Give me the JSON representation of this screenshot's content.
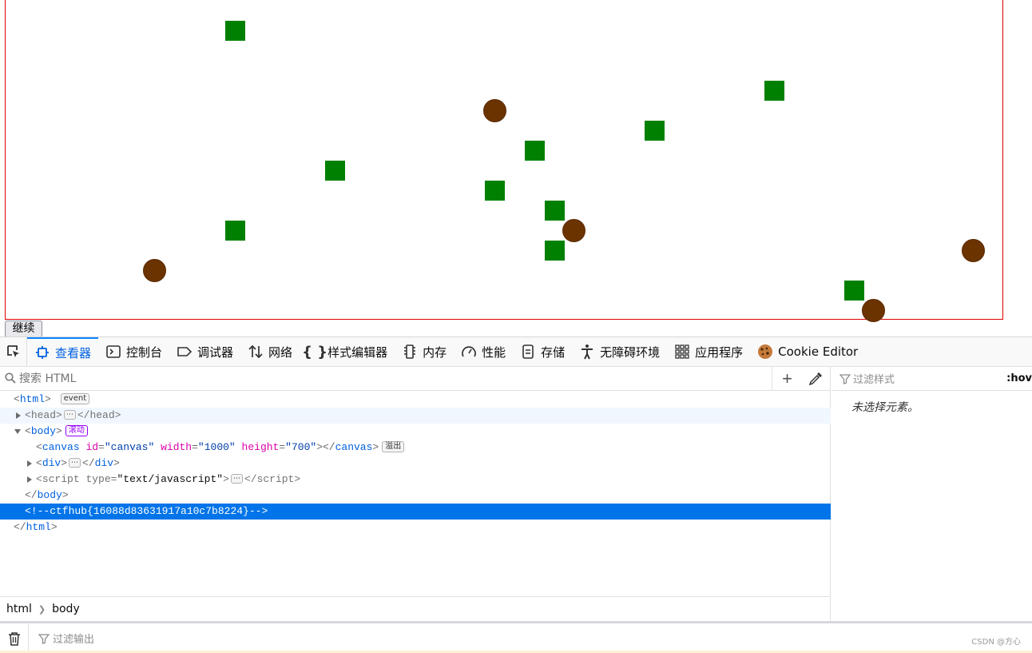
{
  "page": {
    "continue_label": "继续",
    "canvas": {
      "border_color": "#e00000",
      "square_color": "#008000",
      "ball_color": "#6b3300"
    }
  },
  "devtools": {
    "tabs": [
      {
        "label": "查看器",
        "icon": "inspector-icon",
        "active": true
      },
      {
        "label": "控制台",
        "icon": "console-icon"
      },
      {
        "label": "调试器",
        "icon": "debugger-icon"
      },
      {
        "label": "网络",
        "icon": "network-icon"
      },
      {
        "label": "样式编辑器",
        "icon": "style-editor-icon"
      },
      {
        "label": "内存",
        "icon": "memory-icon"
      },
      {
        "label": "性能",
        "icon": "performance-icon"
      },
      {
        "label": "存储",
        "icon": "storage-icon"
      },
      {
        "label": "无障碍环境",
        "icon": "accessibility-icon"
      },
      {
        "label": "应用程序",
        "icon": "application-icon"
      },
      {
        "label": "Cookie Editor",
        "icon": "cookie-icon"
      }
    ],
    "search": {
      "placeholder": "搜索 HTML"
    },
    "tree": {
      "html_open": "html",
      "event_badge": "event",
      "head": "head",
      "body": "body",
      "scroll_badge": "滚动",
      "canvas_tag": "canvas",
      "canvas_id_attr": "id",
      "canvas_id_val": "\"canvas\"",
      "canvas_width_attr": "width",
      "canvas_width_val": "\"1000\"",
      "canvas_height_attr": "height",
      "canvas_height_val": "\"700\"",
      "overflow_badge": "溢出",
      "div": "div",
      "script": "script",
      "script_type_attr": "type",
      "script_type_val": "\"text/javascript\"",
      "comment": "<!--ctfhub{16088d83631917a10c7b8224}-->",
      "ellipsis": "⋯"
    },
    "breadcrumbs": [
      "html",
      "body"
    ],
    "rules": {
      "filter_placeholder": "过滤样式",
      "hov_label": ":hov",
      "empty_message": "未选择元素。"
    },
    "console": {
      "filter_placeholder": "过滤输出"
    },
    "watermark": "CSDN @方心",
    "accent": "#0074e8"
  }
}
